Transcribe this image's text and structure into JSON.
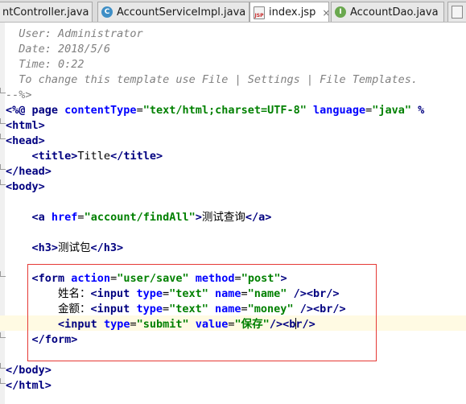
{
  "tabs": [
    {
      "label": "ntController.java",
      "icon": "java-class-icon",
      "icon_glyph": "",
      "icon_color": "#4a8fc7",
      "active": false
    },
    {
      "label": "AccountServiceImpl.java",
      "icon": "java-class-icon",
      "icon_glyph": "C",
      "icon_color": "#3f8fc6",
      "active": false
    },
    {
      "label": "index.jsp",
      "icon": "jsp-file-icon",
      "icon_glyph": "JSP",
      "icon_color": "#c62828",
      "active": true
    },
    {
      "label": "AccountDao.java",
      "icon": "java-interface-icon",
      "icon_glyph": "I",
      "icon_color": "#6aa84f",
      "active": false
    }
  ],
  "tab_close_glyph": "×",
  "code": {
    "comment_user": "  User: Administrator",
    "comment_date": "  Date: 2018/5/6",
    "comment_time": "  Time: 0:22",
    "comment_change": "  To change this template use File | Settings | File Templates.",
    "comment_end": "--%>",
    "directive_open": "<%@ ",
    "directive_page": "page ",
    "directive_ct_attr": "contentType",
    "directive_eq1": "=",
    "directive_ct_val": "\"text/html;charset=UTF-8\"",
    "directive_sp": " ",
    "directive_lang_attr": "language",
    "directive_eq2": "=",
    "directive_lang_val": "\"java\"",
    "directive_rest": " %",
    "html_open": "<html>",
    "head_open": "<head>",
    "title_indent": "    ",
    "title_open": "<title>",
    "title_text": "Title",
    "title_close": "</title>",
    "head_close": "</head>",
    "body_open": "<body>",
    "a_indent": "    ",
    "a_open": "<a ",
    "a_href_attr": "href",
    "a_eq": "=",
    "a_href_val": "\"account/findAll\"",
    "a_gt": ">",
    "a_text": "测试查询",
    "a_close": "</a>",
    "h3_indent": "    ",
    "h3_open": "<h3>",
    "h3_text": "测试包",
    "h3_close": "</h3>",
    "form_indent": "    ",
    "form_open": "<form ",
    "form_action_attr": "action",
    "form_eq1": "=",
    "form_action_val": "\"user/save\"",
    "form_sp": " ",
    "form_method_attr": "method",
    "form_eq2": "=",
    "form_method_val": "\"post\"",
    "form_gt": ">",
    "name_indent": "        ",
    "name_label": "姓名：",
    "name_input_open": "<input ",
    "name_type_attr": "type",
    "name_eq1": "=",
    "name_type_val": "\"text\"",
    "name_sp": " ",
    "name_name_attr": "name",
    "name_eq2": "=",
    "name_name_val": "\"name\"",
    "name_end": " />",
    "name_br": "<br/>",
    "money_indent": "        ",
    "money_label": "金额：",
    "money_input_open": "<input ",
    "money_type_attr": "type",
    "money_eq1": "=",
    "money_type_val": "\"text\"",
    "money_sp": " ",
    "money_name_attr": "name",
    "money_eq2": "=",
    "money_name_val": "\"money\"",
    "money_end": " />",
    "money_br": "<br/>",
    "submit_indent": "        ",
    "submit_input_open": "<input ",
    "submit_type_attr": "type",
    "submit_eq1": "=",
    "submit_type_val": "\"submit\"",
    "submit_sp": " ",
    "submit_value_attr": "value",
    "submit_eq2": "=",
    "submit_value_val": "\"保存\"",
    "submit_end": "/>",
    "submit_br": "<br/>",
    "form_close_indent": "    ",
    "form_close": "</form>",
    "body_close": "</body>",
    "html_close": "</html>"
  }
}
